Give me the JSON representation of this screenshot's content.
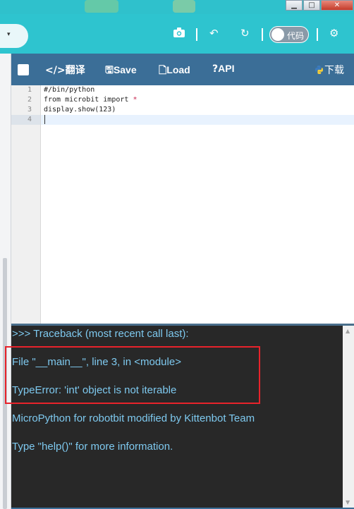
{
  "window": {
    "minimize": "▁",
    "maximize": "□",
    "close": "✕"
  },
  "toolbar": {
    "lang_pill_text": "",
    "lang_pill_caret": "▾",
    "camera": "📷",
    "undo": "↶",
    "refresh": "↻",
    "toggle_label": "代码",
    "settings": "⚙"
  },
  "editor_header": {
    "checkbox": "",
    "translate_icon": "</>",
    "translate_label": "翻译",
    "save_icon": "🖫",
    "save_label": "Save",
    "load_icon": "🗋",
    "load_label": "Load",
    "api_icon": "?",
    "api_label": "API",
    "download_label": "下载"
  },
  "code": {
    "line_numbers": [
      "1",
      "2",
      "3",
      "4"
    ],
    "lines": [
      {
        "text": "#/bin/python",
        "op": ""
      },
      {
        "text": "from microbit import ",
        "op": "*"
      },
      {
        "text": "display.show(123)",
        "op": ""
      },
      {
        "text": "",
        "op": ""
      }
    ]
  },
  "console": {
    "lines": [
      ">>> Traceback (most recent call last):",
      "File \"__main__\", line 3, in <module>",
      "TypeError: 'int' object is not iterable",
      "MicroPython for robotbit modified by Kittenbot Team",
      "Type \"help()\" for more information."
    ],
    "scroll_up": "▲",
    "scroll_down": "▼"
  },
  "colors": {
    "toolbar": "#2ec4cf",
    "editor_header": "#3b6e97",
    "console_bg": "#282828",
    "console_text": "#7ec9ef",
    "highlight_box": "#e8232b"
  }
}
